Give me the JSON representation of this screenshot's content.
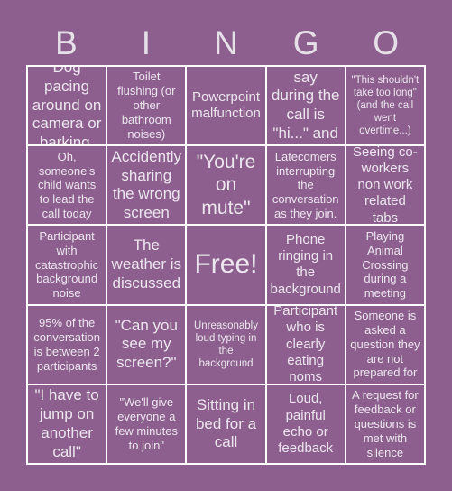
{
  "header": {
    "letters": [
      "B",
      "I",
      "N",
      "G",
      "O"
    ]
  },
  "colors": {
    "background": "#8d5f8e",
    "grid_lines": "#ffffff",
    "text": "#ece6ee"
  },
  "board": {
    "cells": [
      "Dog pacing around on camera or barking.",
      "Toilet flushing (or other bathroom noises)",
      "Powerpoint malfunction",
      "All you say during the call is \"hi...\" and \"bye\"",
      "\"This shouldn't take too long\" (and the call went overtime...)",
      "Oh, someone's child wants to lead the call today",
      "Accidently sharing the wrong screen",
      "\"You're on mute\"",
      "Latecomers interrupting the conversation as they join.",
      "Seeing co-workers non work related tabs",
      "Participant with catastrophic background noise",
      "The weather is discussed",
      "Free!",
      "Phone ringing in the background",
      "Playing Animal Crossing during a meeting",
      "95% of the conversation is between 2 participants",
      "\"Can you see my screen?\"",
      "Unreasonably loud typing in the background",
      "Participant who is clearly eating noms",
      "Someone is asked a question they are not prepared for",
      "\"I have to jump on another call\"",
      "\"We'll give everyone a few minutes to join\"",
      "Sitting in bed for a call",
      "Loud, painful echo or feedback",
      "A request for feedback or questions is met with silence"
    ]
  }
}
